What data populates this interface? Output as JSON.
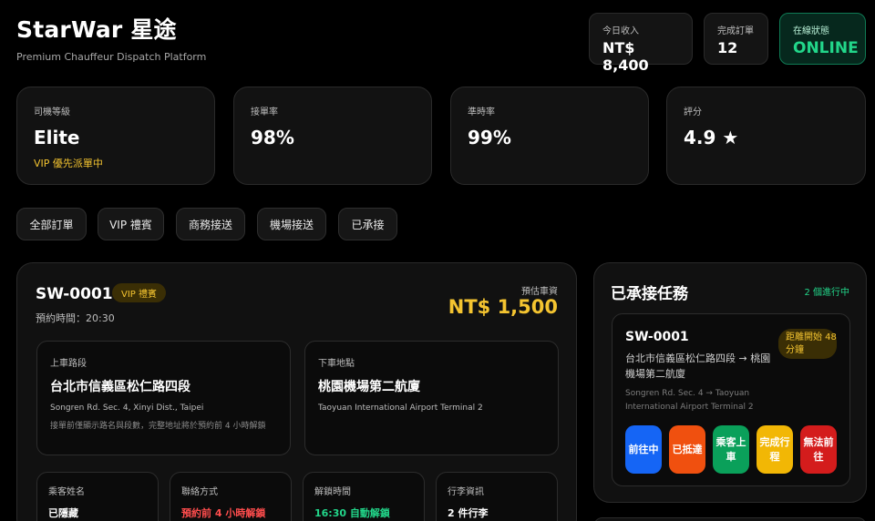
{
  "header": {
    "title": "StarWar 星途",
    "tagline": "Premium Chauffeur Dispatch Platform"
  },
  "stats": {
    "income_label": "今日收入",
    "income_value": "NT$ 8,400",
    "orders_label": "完成訂單",
    "orders_value": "12",
    "status_label": "在線狀態",
    "status_value": "ONLINE"
  },
  "metrics": [
    {
      "label": "司機等級",
      "value": "Elite",
      "sub": "VIP 優先派單中"
    },
    {
      "label": "接單率",
      "value": "98%"
    },
    {
      "label": "準時率",
      "value": "99%"
    },
    {
      "label": "評分",
      "value": "4.9 ★"
    }
  ],
  "filters": [
    "全部訂單",
    "VIP 禮賓",
    "商務接送",
    "機場接送",
    "已承接"
  ],
  "order": {
    "id": "SW-0001",
    "badge": "VIP 禮賓",
    "schedule": "預約時間：20:30",
    "fare_label": "預估車資",
    "fare_value": "NT$ 1,500",
    "pickup": {
      "label": "上車路段",
      "main": "台北市信義區松仁路四段",
      "en": "Songren Rd. Sec. 4, Xinyi Dist., Taipei",
      "note": "接單前僅顯示路名與段數，完整地址將於預約前 4 小時解鎖"
    },
    "dropoff": {
      "label": "下車地點",
      "main": "桃園機場第二航廈",
      "en": "Taoyuan International Airport Terminal 2"
    },
    "info": [
      {
        "label": "乘客姓名",
        "value": "已隱藏"
      },
      {
        "label": "聯絡方式",
        "value": "預約前 4 小時解鎖"
      },
      {
        "label": "解鎖時間",
        "value": "16:30 自動解鎖"
      },
      {
        "label": "行李資訊",
        "value": "2 件行李"
      }
    ]
  },
  "side": {
    "title": "已承接任務",
    "count": "2 個進行中",
    "task": {
      "id": "SW-0001",
      "badge": "距離開始 48 分鐘",
      "route": "台北市信義區松仁路四段 → 桃園機場第二航廈",
      "route_en": "Songren Rd. Sec. 4 → Taoyuan International Airport Terminal 2",
      "actions": [
        "前往中",
        "已抵達",
        "乘客上車",
        "完成行程",
        "無法前往"
      ]
    }
  },
  "colors": {
    "accent_gold": "#f4c430",
    "online_green": "#22d68a",
    "action_blue": "#1565f5",
    "action_orange": "#f0500f",
    "action_green": "#0aa05a",
    "action_yellow": "#f2b705",
    "action_red": "#d41c1c"
  }
}
